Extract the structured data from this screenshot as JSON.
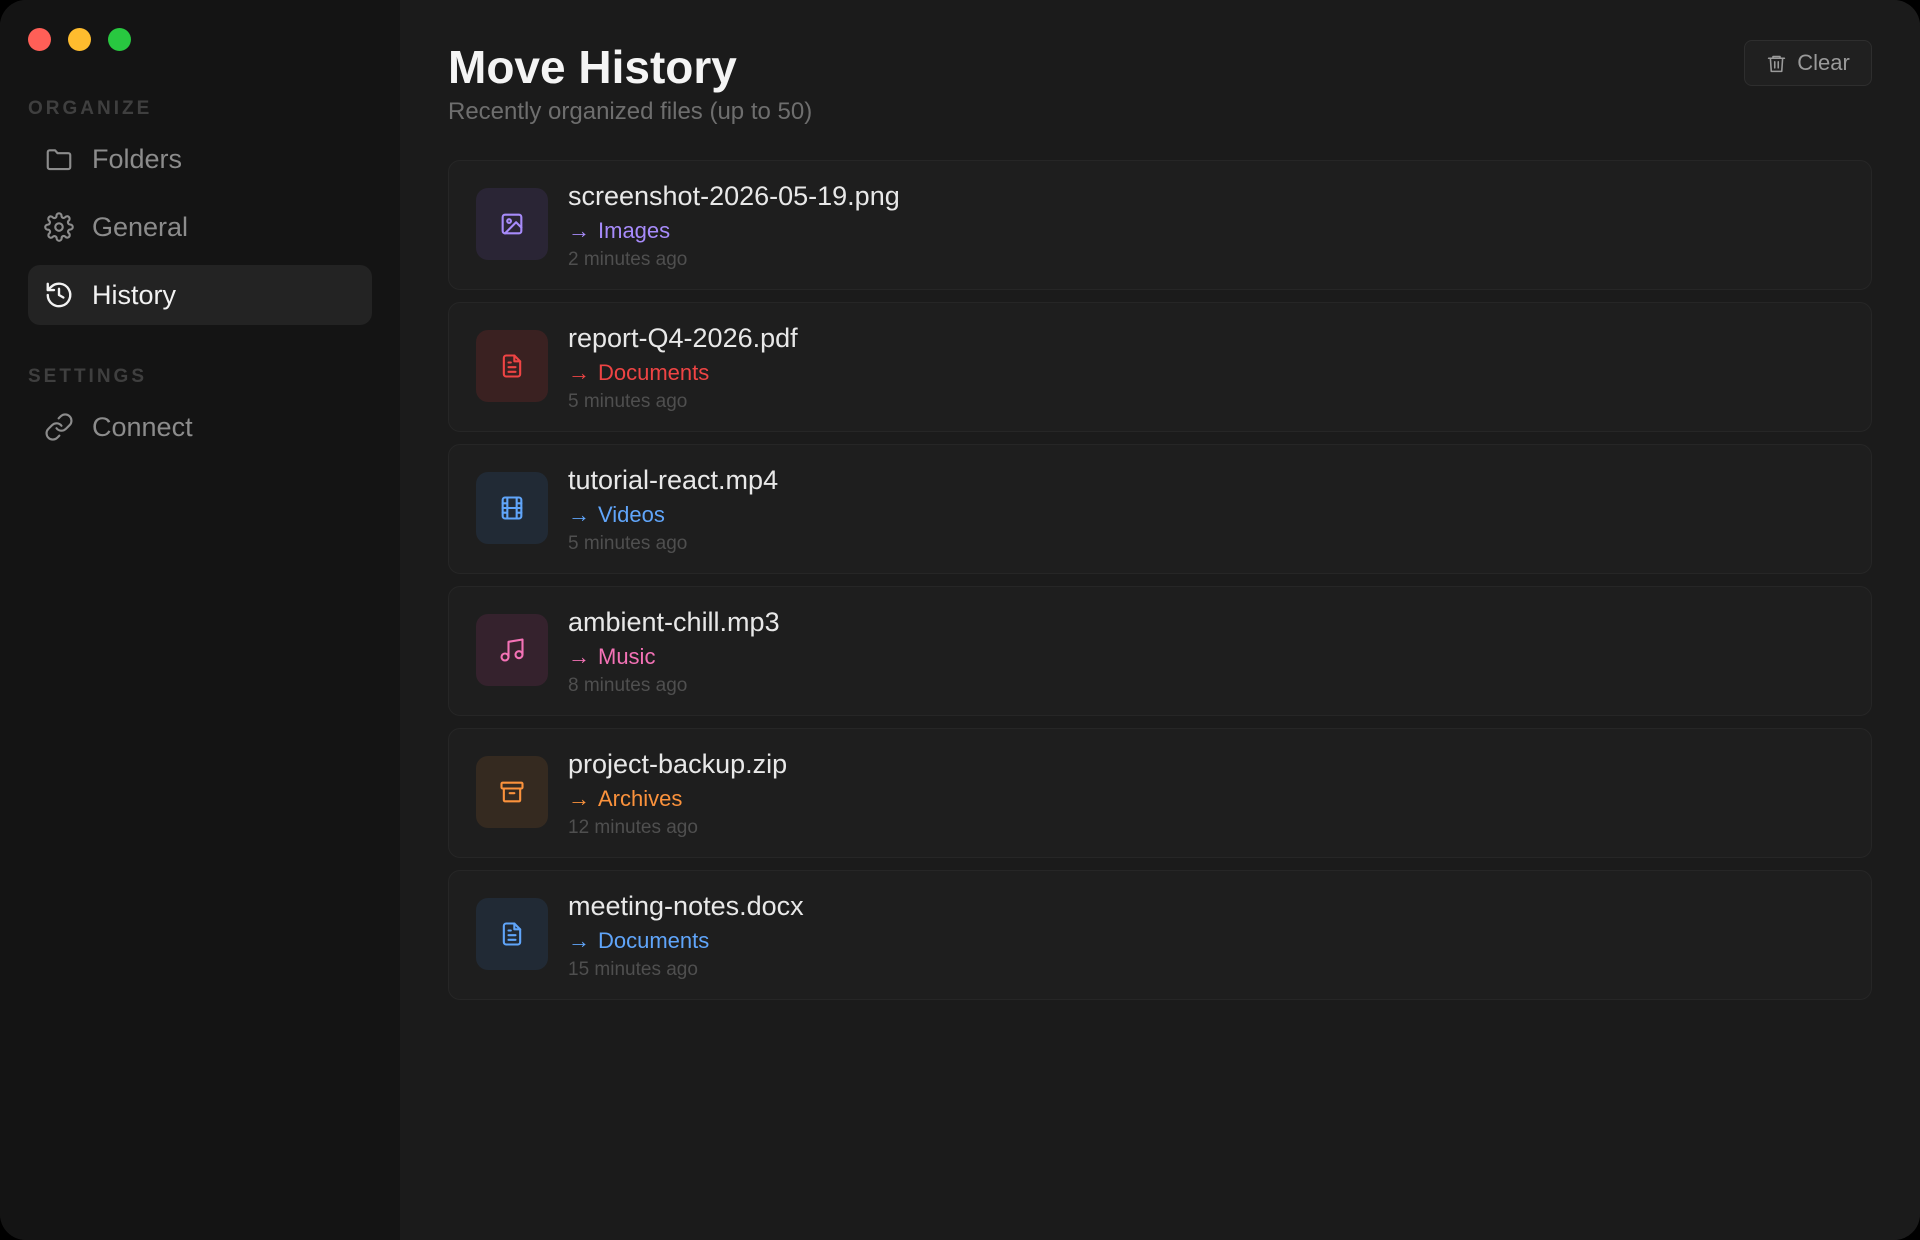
{
  "window": {
    "controls": [
      "close",
      "minimize",
      "maximize"
    ]
  },
  "sidebar": {
    "sections": [
      {
        "label": "ORGANIZE",
        "items": [
          {
            "label": "Folders",
            "icon": "folder-icon",
            "active": false
          },
          {
            "label": "General",
            "icon": "gear-icon",
            "active": false
          },
          {
            "label": "History",
            "icon": "history-icon",
            "active": true
          }
        ]
      },
      {
        "label": "SETTINGS",
        "items": [
          {
            "label": "Connect",
            "icon": "link-icon",
            "active": false
          }
        ]
      }
    ]
  },
  "header": {
    "title": "Move History",
    "subtitle": "Recently organized files (up to 50)",
    "clear_label": "Clear"
  },
  "history": [
    {
      "file": "screenshot-2026-05-19.png",
      "arrow": "→",
      "destination": "Images",
      "time": "2 minutes ago",
      "icon": "image-icon",
      "color": "#a78bfa",
      "bg": "#2a2535"
    },
    {
      "file": "report-Q4-2026.pdf",
      "arrow": "→",
      "destination": "Documents",
      "time": "5 minutes ago",
      "icon": "file-text-icon",
      "color": "#ef4444",
      "bg": "#3a2121"
    },
    {
      "file": "tutorial-react.mp4",
      "arrow": "→",
      "destination": "Videos",
      "time": "5 minutes ago",
      "icon": "film-icon",
      "color": "#60a5fa",
      "bg": "#212a35"
    },
    {
      "file": "ambient-chill.mp3",
      "arrow": "→",
      "destination": "Music",
      "time": "8 minutes ago",
      "icon": "music-icon",
      "color": "#f472b6",
      "bg": "#35222d"
    },
    {
      "file": "project-backup.zip",
      "arrow": "→",
      "destination": "Archives",
      "time": "12 minutes ago",
      "icon": "archive-icon",
      "color": "#fb923c",
      "bg": "#352a20"
    },
    {
      "file": "meeting-notes.docx",
      "arrow": "→",
      "destination": "Documents",
      "time": "15 minutes ago",
      "icon": "file-text-icon",
      "color": "#60a5fa",
      "bg": "#212a35"
    }
  ],
  "colors": {
    "window_bg": "#1b1b1b",
    "sidebar_bg": "#141414",
    "active_item_bg": "#232323",
    "close": "#ff5f57",
    "minimize": "#febc2e",
    "maximize": "#28c840"
  }
}
